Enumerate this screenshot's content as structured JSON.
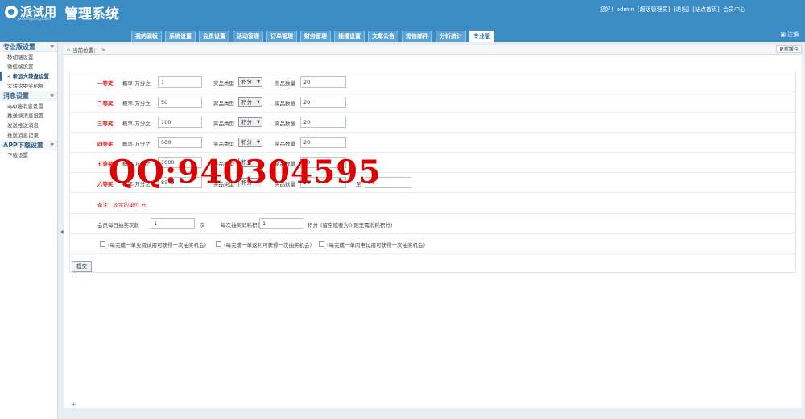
{
  "header": {
    "logo_text": "派试用",
    "logo_sub": "pnoshiyong.com",
    "title": "管理系统",
    "greeting": "您好！admin",
    "role": "[超级管理员]",
    "logout_link": "[退出]",
    "home_link": "[站点首页]",
    "member_center": "会员中心",
    "logout_btn": "注销"
  },
  "nav": {
    "tabs": [
      "我的面板",
      "系统设置",
      "会员设置",
      "活动管理",
      "订单管理",
      "财务管理",
      "插播设置",
      "文章公告",
      "短信邮件",
      "分析统计",
      "专业版"
    ],
    "active": "专业版"
  },
  "sidebar": {
    "sections": [
      {
        "title": "专业版设置",
        "items": [
          "移动端设置",
          "微信端设置",
          "幸运大转盘设置",
          "大转盘中奖明细"
        ],
        "active": "幸运大转盘设置"
      },
      {
        "title": "消息设置",
        "items": [
          "app端消息设置",
          "推送端消息设置",
          "发送推送消息",
          "推送消息记录"
        ]
      },
      {
        "title": "APP下载设置",
        "items": [
          "下载设置"
        ]
      }
    ]
  },
  "breadcrumb": {
    "label": "当前位置：",
    "sep": ">"
  },
  "refresh_btn": "更新缓存",
  "prize_rows": [
    {
      "name": "一等奖",
      "prob_label": "概率-万分之",
      "prob": "1",
      "type_label": "奖品类型",
      "type": "积分",
      "qty_label": "奖品数量",
      "qty": "20"
    },
    {
      "name": "二等奖",
      "prob_label": "概率-万分之",
      "prob": "50",
      "type_label": "奖品类型",
      "type": "积分",
      "qty_label": "奖品数量",
      "qty": "20"
    },
    {
      "name": "三等奖",
      "prob_label": "概率-万分之",
      "prob": "100",
      "type_label": "奖品类型",
      "type": "积分",
      "qty_label": "奖品数量",
      "qty": "20"
    },
    {
      "name": "四等奖",
      "prob_label": "概率-万分之",
      "prob": "500",
      "type_label": "奖品类型",
      "type": "积分",
      "qty_label": "奖品数量",
      "qty": "20"
    },
    {
      "name": "五等奖",
      "prob_label": "概率-万分之",
      "prob": "1000",
      "type_label": "奖品类型",
      "type": "积分",
      "qty_label": "奖品数量",
      "qty": "20"
    },
    {
      "name": "六等奖",
      "prob_label": "概率-万分之",
      "prob": "8349",
      "type_label": "奖品类型",
      "type": "积分",
      "qty_label": "奖品数量",
      "qty": "20",
      "range_sep": "至",
      "range_to": "50"
    }
  ],
  "note": "备注：现金的单位 元",
  "daily": {
    "label": "会员每日抽奖次数",
    "value": "1",
    "unit": "次",
    "cost_label": "每次抽奖消耗积分",
    "cost": "1",
    "cost_unit": "积分",
    "cost_hint": "(留空或者为0 则无需消耗积分)"
  },
  "checks": [
    "(每完成一单免费试用可获得一次抽奖机会)",
    "(每完成一单返利可获得一次抽奖机会)",
    "(每完成一单闪电试用可获得一次抽奖机会)"
  ],
  "submit": "提交",
  "watermark": "QQ:940304595"
}
